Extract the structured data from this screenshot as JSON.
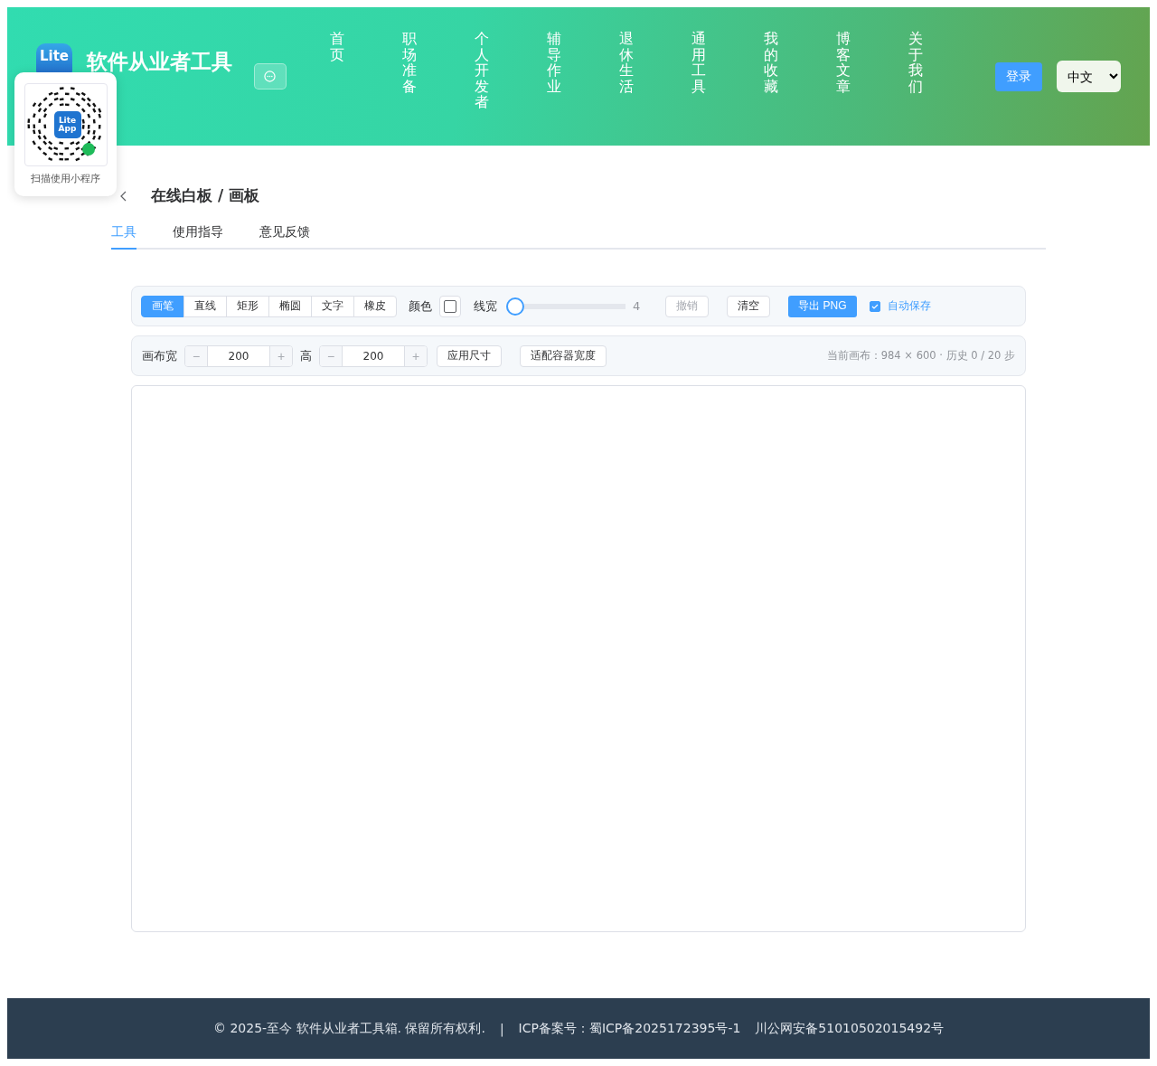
{
  "header": {
    "logo_text": "Lite",
    "title": "软件从业者工具",
    "nav": [
      {
        "label": "首页"
      },
      {
        "label": "职场准备"
      },
      {
        "label": "个人开发者"
      },
      {
        "label": "辅导作业"
      },
      {
        "label": "退休生活"
      },
      {
        "label": "通用工具"
      },
      {
        "label": "我的收藏"
      },
      {
        "label": "博客文章"
      },
      {
        "label": "关于我们"
      }
    ],
    "login": "登录",
    "language": "中文"
  },
  "qr_popover": {
    "logo_lines": [
      "Lite",
      "App"
    ],
    "caption": "扫描使用小程序"
  },
  "page": {
    "title": "在线白板 / 画板",
    "tabs": [
      {
        "label": "工具",
        "selected": true
      },
      {
        "label": "使用指导",
        "selected": false
      },
      {
        "label": "意见反馈",
        "selected": false
      }
    ]
  },
  "toolbar": {
    "tools": [
      {
        "label": "画笔",
        "selected": true
      },
      {
        "label": "直线",
        "selected": false
      },
      {
        "label": "矩形",
        "selected": false
      },
      {
        "label": "椭圆",
        "selected": false
      },
      {
        "label": "文字",
        "selected": false
      },
      {
        "label": "橡皮",
        "selected": false
      }
    ],
    "color_label": "颜色",
    "width_label": "线宽",
    "width": {
      "level": 0.0
    },
    "width_reading": "4",
    "undo": {
      "label": "撤销",
      "disabled": true
    },
    "clear": {
      "label": "清空",
      "disabled": false
    },
    "export": "导出 PNG",
    "autosave": {
      "label": "自动保存",
      "checked": true
    }
  },
  "size_bar": {
    "minus": "−",
    "plus": "+",
    "width_label": "画布宽",
    "width_value": "200",
    "height_label": "高",
    "height_value": "200",
    "apply": "应用尺寸",
    "fit": "适配容器宽度",
    "status": "当前画布：984 × 600 · 历史 0 / 20 步"
  },
  "footer": {
    "copyright": "© 2025-至今 软件从业者工具箱. 保留所有权利.",
    "separator": "|",
    "icp": "ICP备案号：蜀ICP备2025172395号-1",
    "police": "川公网安备51010502015492号"
  }
}
